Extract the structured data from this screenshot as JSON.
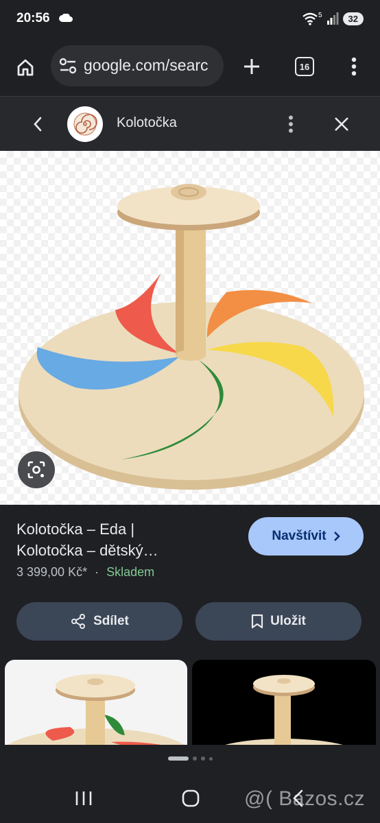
{
  "status_bar": {
    "time": "20:56",
    "battery": "32",
    "network_badge": "5"
  },
  "browser": {
    "url": "google.com/searc",
    "tab_count": "16"
  },
  "lens_header": {
    "title": "Kolotočka"
  },
  "product": {
    "title_line1": "Kolotočka – Eda |",
    "title_line2": "Kolotočka – dětský…",
    "price": "3 399,00 Kč*",
    "separator": "·",
    "stock": "Skladem",
    "visit_label": "Navštívit",
    "share_label": "Sdílet",
    "save_label": "Uložit"
  },
  "watermark": "@( Bazos.cz",
  "icons": [
    "cloud-icon",
    "wifi-icon",
    "signal-icon",
    "home-icon",
    "tune-icon",
    "plus-icon",
    "menu-dots-icon",
    "back-icon",
    "close-icon",
    "lens-icon",
    "chevron-right-icon",
    "share-icon",
    "bookmark-icon",
    "recents-icon",
    "home-nav-icon",
    "back-nav-icon"
  ],
  "colors": {
    "visit_button": "#a8c7fa",
    "pill_button": "#3b4657",
    "stock_text": "#81c995",
    "background": "#1f2023"
  }
}
